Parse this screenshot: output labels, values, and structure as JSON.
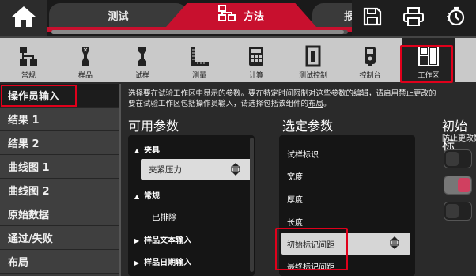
{
  "tabs": {
    "test": "测试",
    "method": "方法",
    "next": "报"
  },
  "icons": {
    "home": "home-icon",
    "save": "save-icon",
    "print": "print-icon",
    "timer": "timer-icon"
  },
  "toolbar": {
    "items": [
      {
        "label": "常规"
      },
      {
        "label": "样品"
      },
      {
        "label": "试样"
      },
      {
        "label": "测量"
      },
      {
        "label": "计算"
      },
      {
        "label": "测试控制"
      },
      {
        "label": "控制台"
      },
      {
        "label": "工作区"
      }
    ]
  },
  "sidebar": {
    "items": [
      {
        "label": "操作员输入"
      },
      {
        "label": "结果 1"
      },
      {
        "label": "结果 2"
      },
      {
        "label": "曲线图 1"
      },
      {
        "label": "曲线图 2"
      },
      {
        "label": "原始数据"
      },
      {
        "label": "通过/失败"
      },
      {
        "label": "布局"
      }
    ]
  },
  "main": {
    "description_line1": "选择要在试验工作区中显示的参数。要在特定时间限制对这些参数的编辑，请启用禁止更改的",
    "description_line2": "要在试验工作区包括操作员输入，请选择包括该组件的",
    "description_link": "布局",
    "description_end": "。",
    "available_title": "可用参数",
    "selected_title": "选定参数",
    "initial_title": "初始标",
    "prevent_change": "防止更改数",
    "available": {
      "group_fixture": "夹具",
      "clamp_pressure": "夹紧压力",
      "group_general": "常规",
      "excluded": "已排除",
      "group_sample_text": "样品文本输入",
      "group_sample_date": "样品日期输入"
    },
    "selected": {
      "items": [
        {
          "label": "试样标识"
        },
        {
          "label": "宽度"
        },
        {
          "label": "厚度"
        },
        {
          "label": "长度"
        },
        {
          "label": "初始标记间距"
        },
        {
          "label": "最终标记间距"
        }
      ]
    }
  },
  "colors": {
    "accent": "#c8102e",
    "highlight": "#e0001b",
    "toggle_on": "#d04060"
  }
}
